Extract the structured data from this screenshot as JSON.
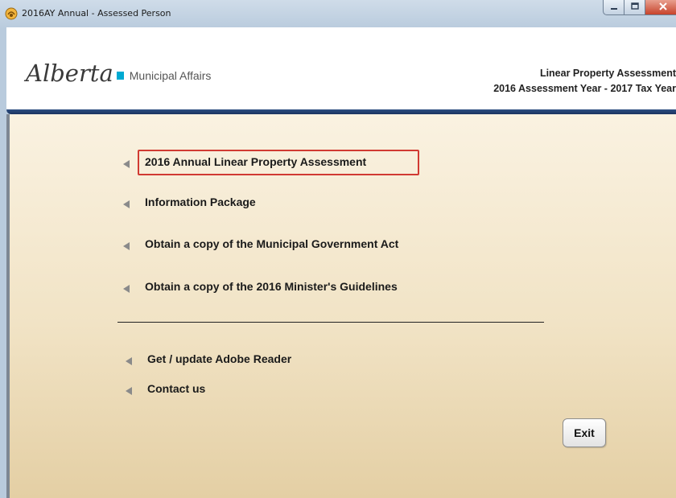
{
  "window": {
    "title": "2016AY Annual - Assessed Person",
    "icon": "app-logo-icon",
    "controls": {
      "minimize": "minimize-icon",
      "maximize": "maximize-icon",
      "close": "close-icon"
    }
  },
  "header": {
    "logo_word": "Alberta",
    "ministry": "Municipal Affairs",
    "title_line1": "Linear Property Assessment",
    "title_line2": "2016 Assessment Year - 2017 Tax Year"
  },
  "menu": {
    "items": [
      {
        "label": "2016 Annual Linear Property Assessment",
        "selected": true
      },
      {
        "label": "Information Package"
      },
      {
        "label": "Obtain a copy of the Municipal Government Act"
      },
      {
        "label": "Obtain a copy of the 2016 Minister's Guidelines"
      },
      {
        "label": "Get / update Adobe Reader"
      },
      {
        "label": "Contact us"
      }
    ],
    "item_icon": "triangle-left-icon"
  },
  "exit_button": {
    "label": "Exit"
  },
  "colors": {
    "accent_blue": "#00aad2",
    "header_rule": "#1b3460",
    "selection_border": "#d13a32",
    "content_bg": "#f1e3c5"
  }
}
